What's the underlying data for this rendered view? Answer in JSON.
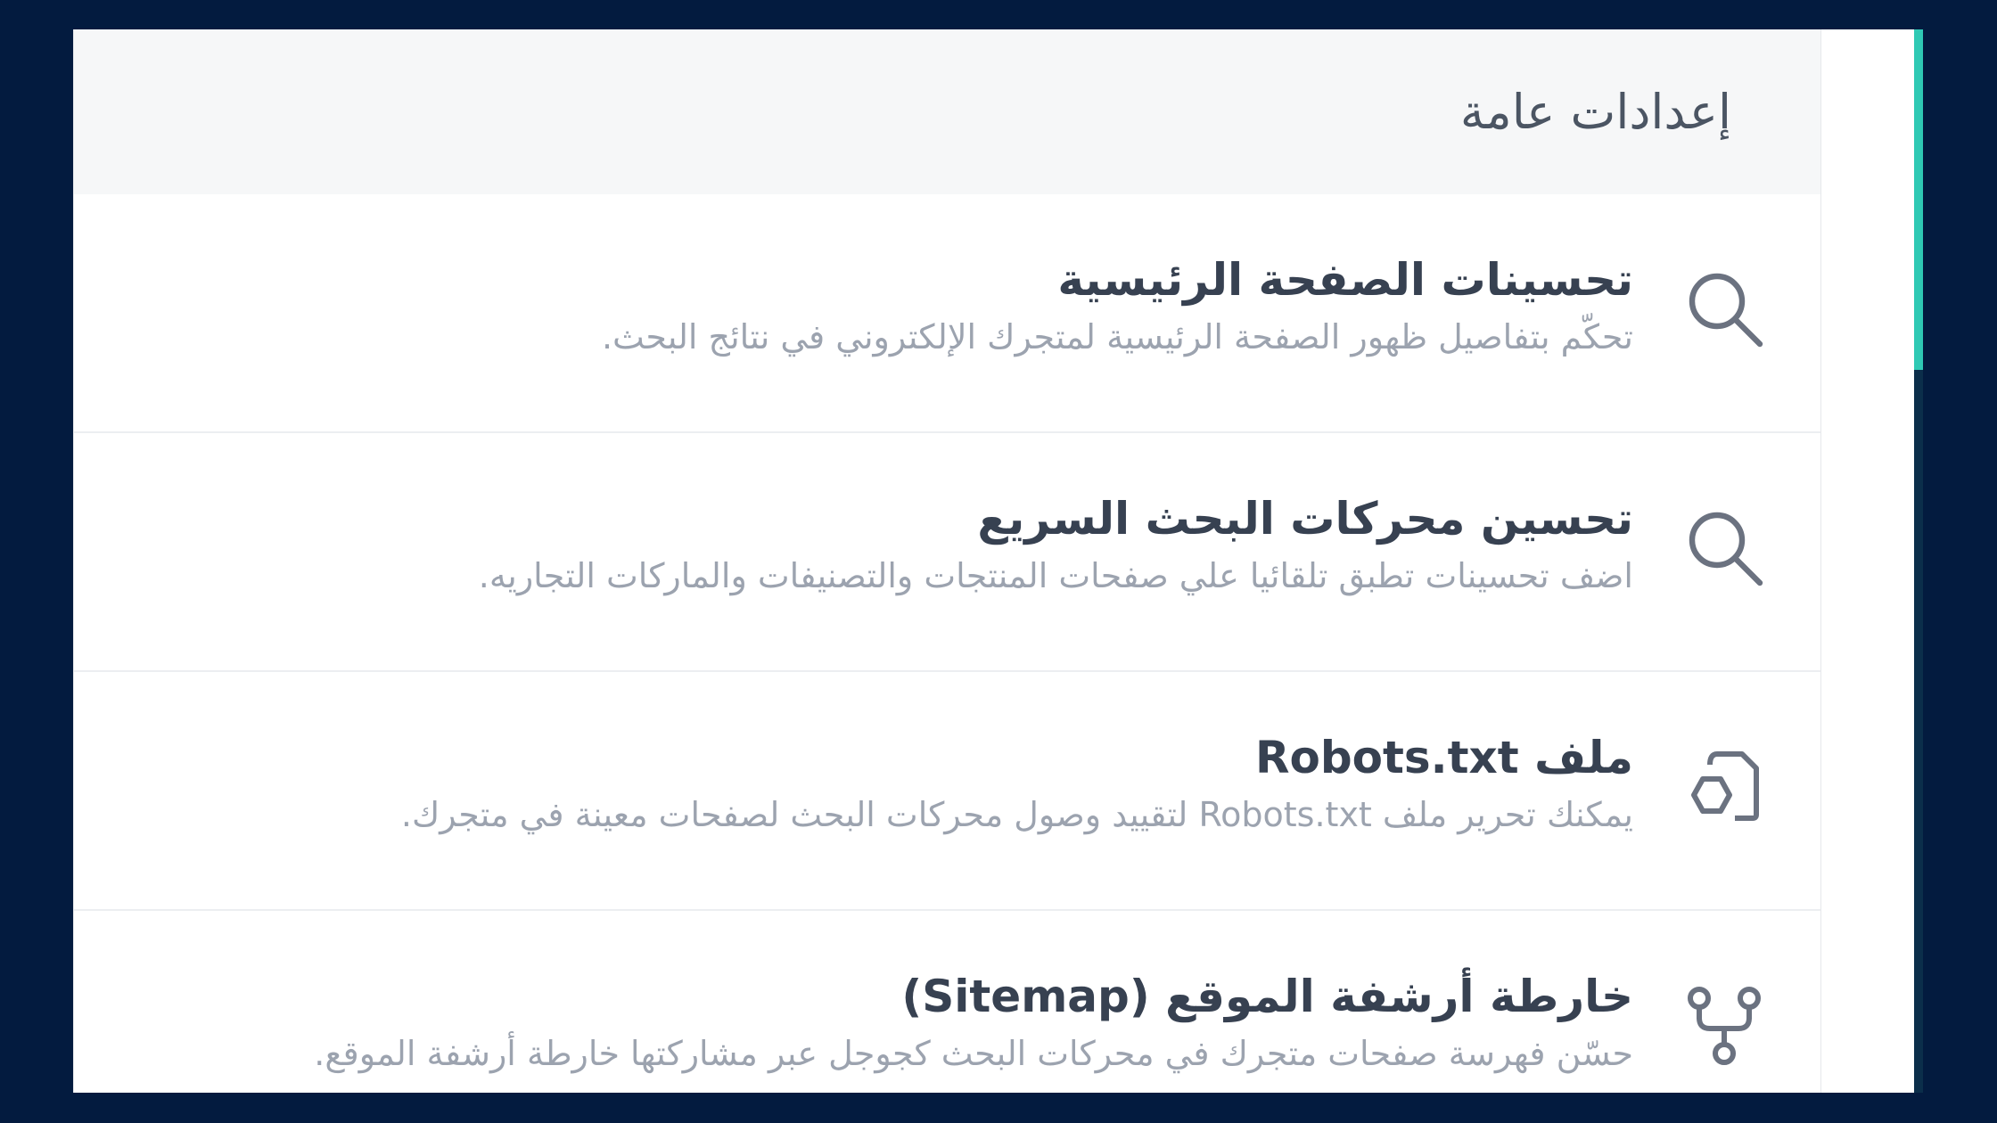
{
  "header": {
    "title": "إعدادات عامة"
  },
  "items": [
    {
      "icon": "search-icon",
      "title": "تحسينات الصفحة الرئيسية",
      "description": "تحكّم بتفاصيل ظهور الصفحة الرئيسية لمتجرك الإلكتروني في نتائج البحث."
    },
    {
      "icon": "search-icon",
      "title": "تحسين محركات البحث السريع",
      "description": "اضف تحسينات تطبق تلقائيا علي صفحات المنتجات والتصنيفات والماركات التجاريه."
    },
    {
      "icon": "file-shapes-icon",
      "title": "ملف Robots.txt",
      "description": "يمكنك تحرير ملف Robots.txt لتقييد وصول محركات البحث لصفحات معينة في متجرك."
    },
    {
      "icon": "sitemap-branch-icon",
      "title": "خارطة أرشفة الموقع (Sitemap)",
      "description": "حسّن فهرسة صفحات متجرك في محركات البحث كجوجل عبر مشاركتها خارطة أرشفة الموقع."
    }
  ],
  "colors": {
    "background": "#031b3f",
    "scrollbar_thumb": "#2fc9b4"
  }
}
